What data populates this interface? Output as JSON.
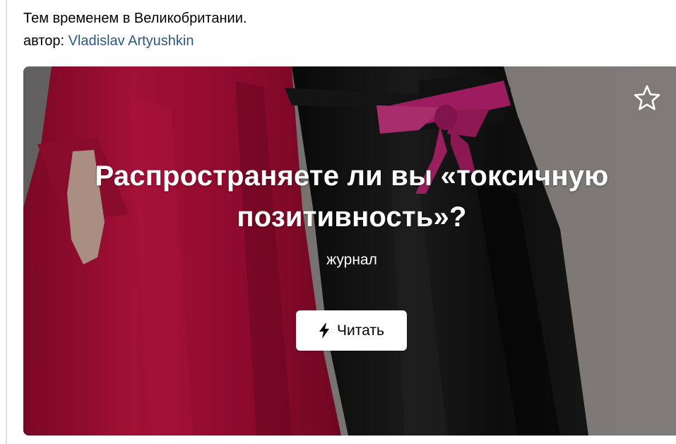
{
  "post": {
    "text": "Тем временем в Великобритании.",
    "author_prefix": "автор: ",
    "author_name": "Vladislav Artyushkin"
  },
  "article_card": {
    "title": "Распространяете ли вы «токсичную позитивность»?",
    "subtitle": "журнал",
    "read_button_label": "Читать",
    "favorite_icon": "star-icon",
    "button_icon": "lightning-icon"
  },
  "colors": {
    "link": "#2a5885",
    "red_dress": "#c8103f",
    "black_dress": "#141414",
    "pink_bow": "#c52b7d",
    "background_gray": "#8f8b89"
  }
}
